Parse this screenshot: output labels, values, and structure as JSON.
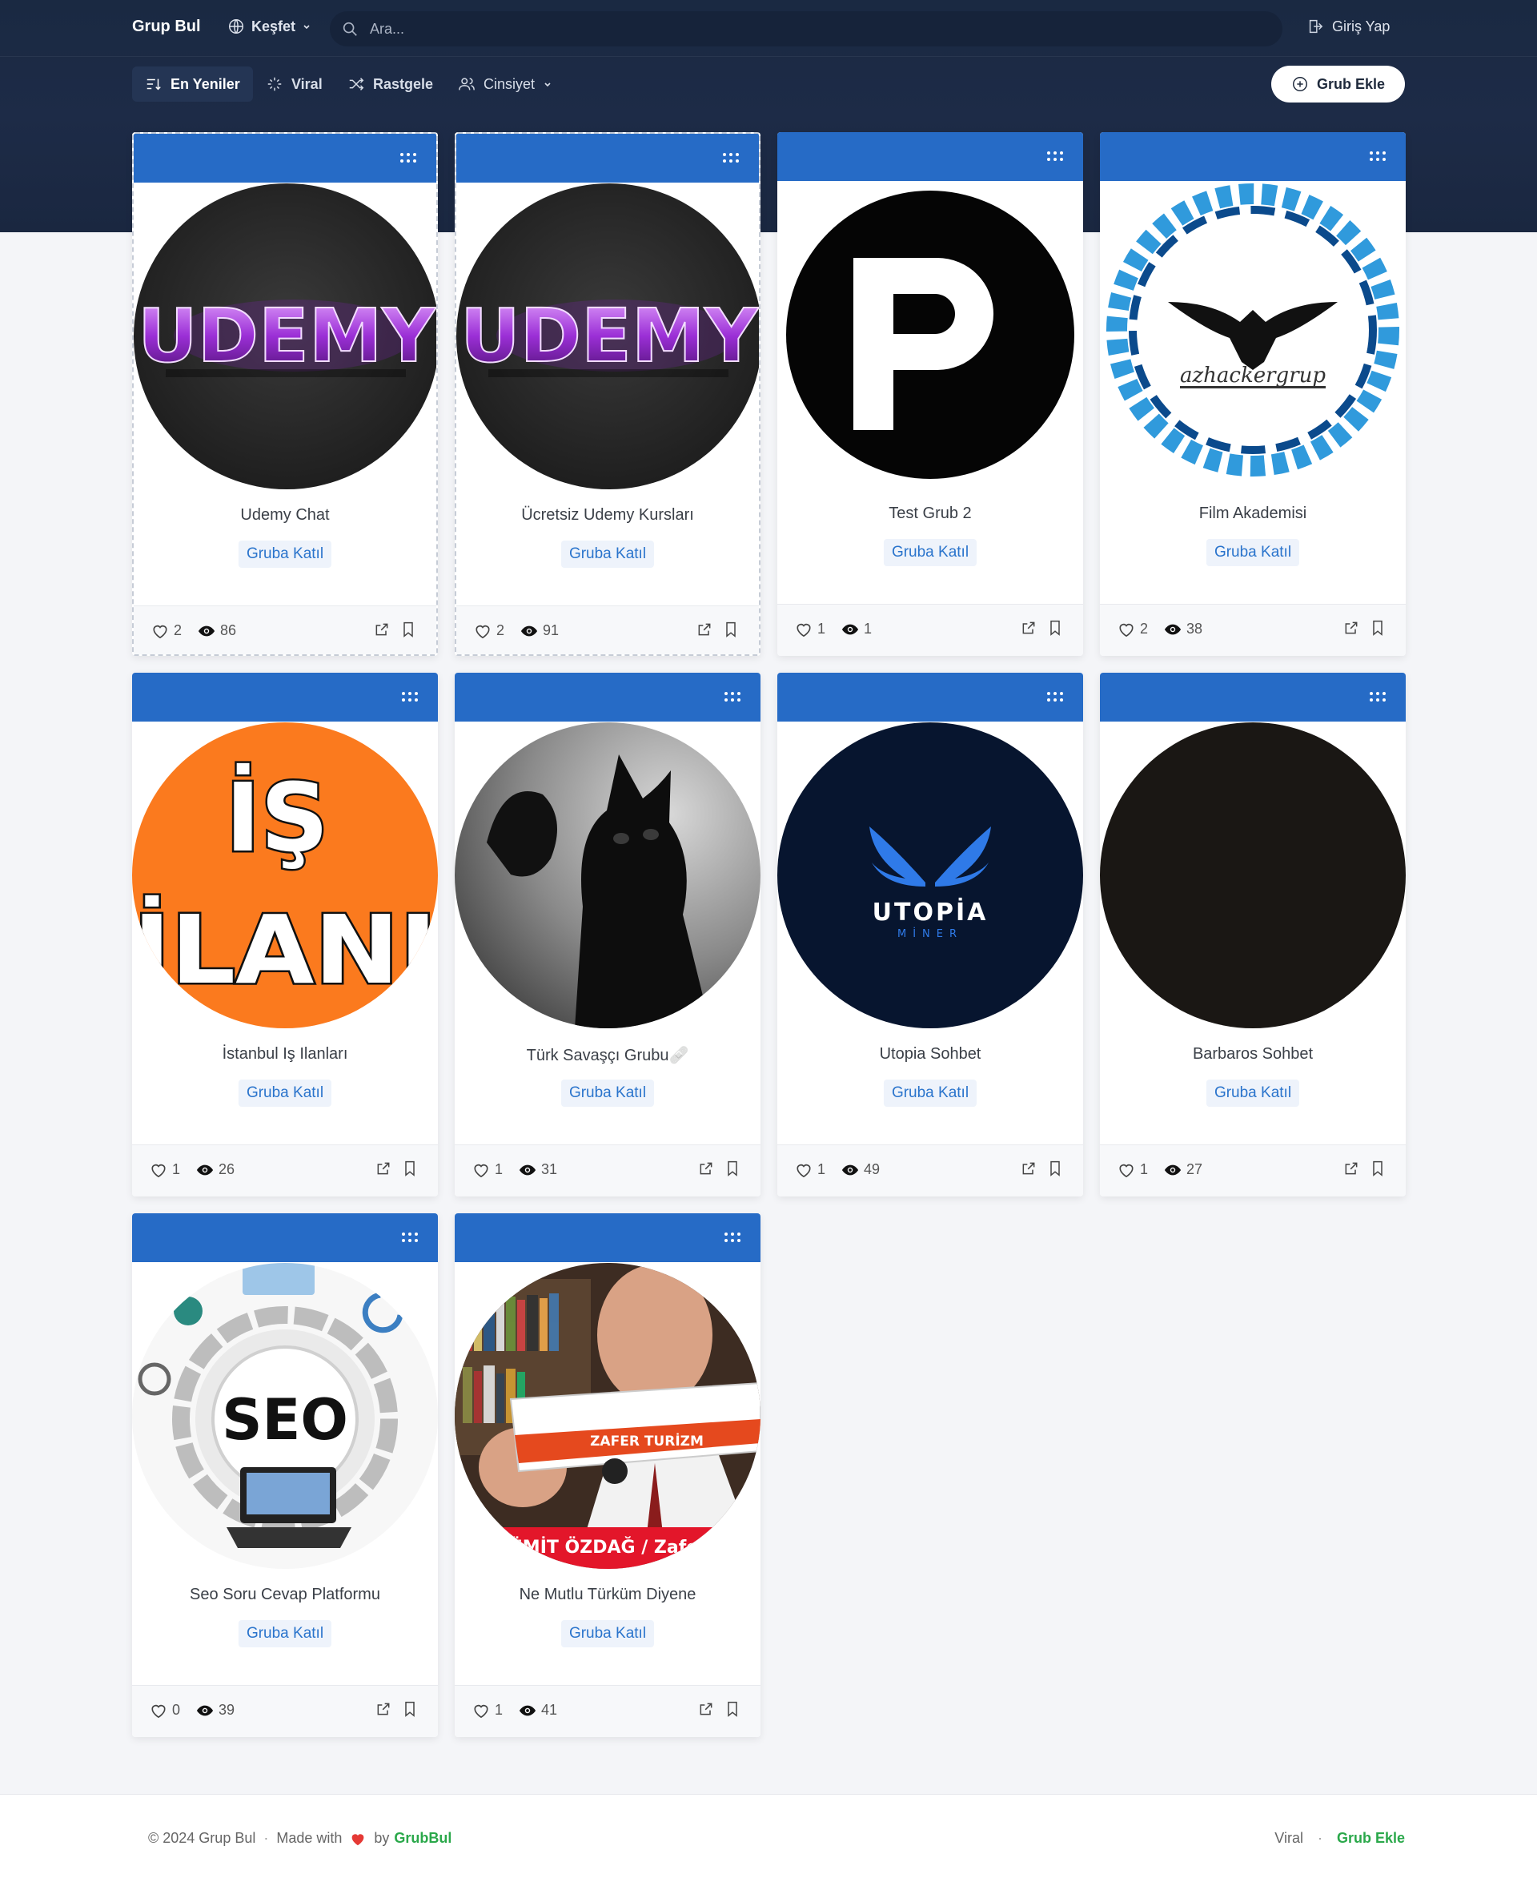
{
  "header": {
    "brand": "Grup Bul",
    "explore_label": "Keşfet",
    "search_placeholder": "Ara...",
    "login_label": "Giriş Yap"
  },
  "filters": {
    "newest": "En Yeniler",
    "viral": "Viral",
    "random": "Rastgele",
    "gender": "Cinsiyet",
    "active": "En Yeniler"
  },
  "add_group_label": "Grub Ekle",
  "join_label": "Gruba Katıl",
  "groups": [
    {
      "title": "Udemy Chat",
      "likes": "2",
      "views": "86",
      "image": "udemy-logo",
      "selected": true
    },
    {
      "title": "Ücretsiz Udemy Kursları",
      "likes": "2",
      "views": "91",
      "image": "udemy-logo",
      "selected": true
    },
    {
      "title": "Test Grub 2",
      "likes": "1",
      "views": "1",
      "image": "p-logo",
      "selected": false
    },
    {
      "title": "Film Akademisi",
      "likes": "2",
      "views": "38",
      "image": "eagle-emblem",
      "selected": false
    },
    {
      "title": "İstanbul Iş Ilanları",
      "likes": "1",
      "views": "26",
      "image": "is-ilani-logo",
      "selected": false
    },
    {
      "title": "Türk Savaşçı Grubu🩹",
      "likes": "1",
      "views": "31",
      "image": "black-cat-photo",
      "selected": false
    },
    {
      "title": "Utopia Sohbet",
      "likes": "1",
      "views": "49",
      "image": "utopia-miner-logo",
      "selected": false
    },
    {
      "title": "Barbaros Sohbet",
      "likes": "1",
      "views": "27",
      "image": "dark-image",
      "selected": false
    },
    {
      "title": "Seo Soru Cevap Platformu",
      "likes": "0",
      "views": "39",
      "image": "seo-illustration",
      "selected": false
    },
    {
      "title": "Ne Mutlu Türküm Diyene",
      "likes": "1",
      "views": "41",
      "image": "man-with-bus-model-photo",
      "selected": false
    }
  ],
  "image_texts": {
    "udemy": "UDEMY",
    "p": "P",
    "eagle_caption": "azhackergrup",
    "is1": "İŞ",
    "is2": "İLANI",
    "utopia": "UTOPİA",
    "utopia_sub": "MİNER",
    "seo": "SEO",
    "bus": "ZAFER TURİZM",
    "banner": "ÜMİT ÖZDAĞ / Zafer"
  },
  "footer": {
    "copyright": "© 2024 Grup Bul",
    "dot": "·",
    "made_with": "Made with",
    "by": "by",
    "brand_link": "GrubBul",
    "viral_link": "Viral",
    "add_link": "Grub Ekle"
  },
  "colors": {
    "header_bg": "#1a2942",
    "card_header": "#266bc6",
    "join_text": "#2a74cc",
    "footer_link": "#2aa84a"
  }
}
